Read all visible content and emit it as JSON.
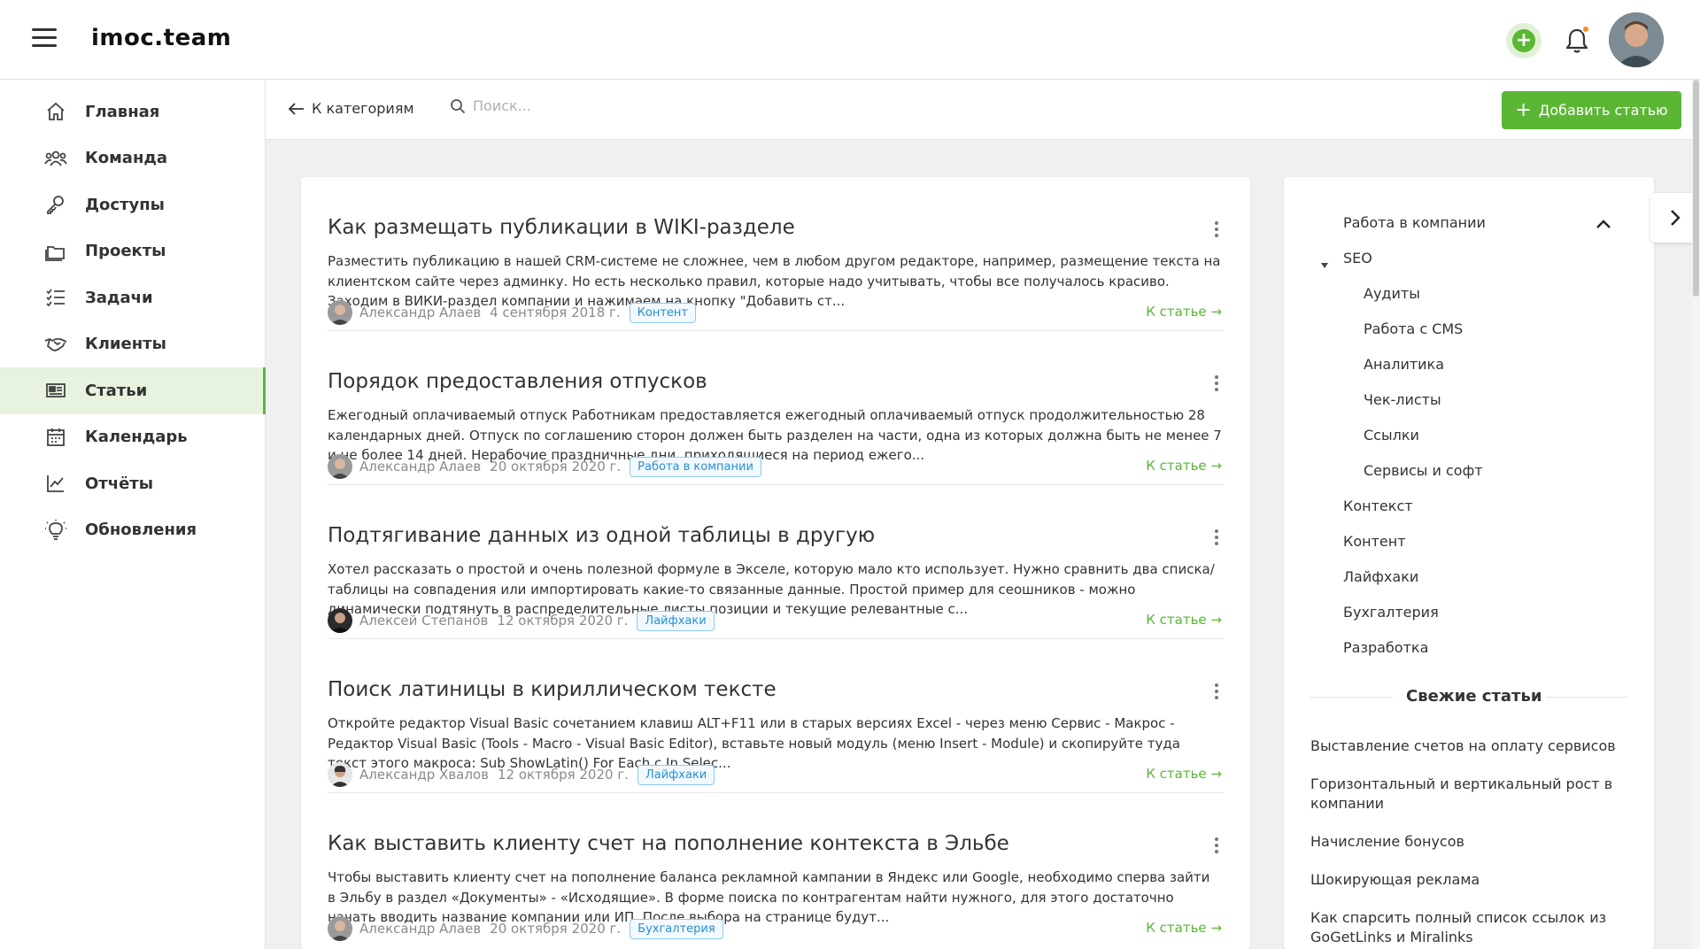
{
  "header": {
    "logo": "imoc.team",
    "notifications_dot_color": "#ff8a1f"
  },
  "colors": {
    "accent": "#5bb635",
    "tag": "#2a8fd1"
  },
  "sidebar": {
    "items": [
      {
        "label": "Главная",
        "icon": "home-icon"
      },
      {
        "label": "Команда",
        "icon": "team-icon"
      },
      {
        "label": "Доступы",
        "icon": "key-icon"
      },
      {
        "label": "Проекты",
        "icon": "folder-icon"
      },
      {
        "label": "Задачи",
        "icon": "tasks-icon"
      },
      {
        "label": "Клиенты",
        "icon": "handshake-icon"
      },
      {
        "label": "Статьи",
        "icon": "newspaper-icon",
        "active": true
      },
      {
        "label": "Календарь",
        "icon": "calendar-icon"
      },
      {
        "label": "Отчёты",
        "icon": "chart-icon"
      },
      {
        "label": "Обновления",
        "icon": "bulb-icon"
      }
    ]
  },
  "toolbar": {
    "back_label": "К категориям",
    "search_placeholder": "Поиск...",
    "add_label": "Добавить статью"
  },
  "articles": [
    {
      "title": "Как размещать публикации в WIKI-разделе",
      "text": "Разместить публикацию в нашей CRM-системе не сложнее, чем в любом другом редакторе, например, размещение текста на клиентском сайте через админку.  Но есть несколько правил, которые надо учитывать, чтобы все получалось красиво.   Заходим в ВИКИ-раздел компании и нажимаем на кнопку \"Добавить ст...",
      "author": "Александр Алаев",
      "date": "4 сентября 2018 г.",
      "tag": "Контент",
      "link": "К статье →"
    },
    {
      "title": "Порядок предоставления отпусков",
      "text": "Ежегодный оплачиваемый отпуск Работникам предоставляется ежегодный оплачиваемый отпуск продолжительностью 28 календарных дней. Отпуск по соглашению сторон должен быть разделен на части, одна из которых должна быть не менее 7 и не более 14 дней. Нерабочие праздничные дни, приходящиеся на период ежего...",
      "author": "Александр Алаев",
      "date": "20 октября 2020 г.",
      "tag": "Работа в компании",
      "link": "К статье →"
    },
    {
      "title": "Подтягивание данных из одной таблицы в другую",
      "text": "Хотел рассказать о простой и очень полезной формуле в Экселе, которую мало кто использует. Нужно сравнить два списка/таблицы на совпадения или импортировать какие-то связанные данные. Простой пример для сеошников - можно динамически подтянуть в распределительные листы позиции и текущие релевантные с...",
      "author": "Алексей Степанов",
      "date": "12 октября 2020 г.",
      "tag": "Лайфхаки",
      "link": "К статье →"
    },
    {
      "title": "Поиск латиницы в кириллическом тексте",
      "text": "Откройте редактор Visual Basic сочетанием клавиш ALT+F11 или в старых версиях Excel - через меню Сервис - Макрос - Редактор Visual Basic (Tools - Macro - Visual Basic Editor), вставьте новый модуль (меню Insert - Module) и скопируйте туда текст этого макроса: Sub ShowLatin()  For Each c In Selec...",
      "author": "Александр Хвалов",
      "date": "12 октября 2020 г.",
      "tag": "Лайфхаки",
      "link": "К статье →"
    },
    {
      "title": "Как выставить клиенту счет на пополнение контекста в Эльбе",
      "text": "Чтобы выставить клиенту счет на пополнение баланса рекламной кампании в Яндекс или Google, необходимо сперва зайти в Эльбу в раздел «Документы» - «Исходящие». В форме поиска по контрагентам найти нужного, для этого достаточно начать вводить название компании или ИП. После выбора на странице будут...",
      "author": "Александр Алаев",
      "date": "20 октября 2020 г.",
      "tag": "Бухгалтерия",
      "link": "К статье →"
    }
  ],
  "categories": [
    {
      "label": "Работа в компании",
      "level": 0
    },
    {
      "label": "SEO",
      "level": 0,
      "expanded": true
    },
    {
      "label": "Аудиты",
      "level": 1
    },
    {
      "label": "Работа с CMS",
      "level": 1
    },
    {
      "label": "Аналитика",
      "level": 1
    },
    {
      "label": "Чек-листы",
      "level": 1
    },
    {
      "label": "Ссылки",
      "level": 1
    },
    {
      "label": "Сервисы и софт",
      "level": 1
    },
    {
      "label": "Контекст",
      "level": 0
    },
    {
      "label": "Контент",
      "level": 0
    },
    {
      "label": "Лайфхаки",
      "level": 0
    },
    {
      "label": "Бухгалтерия",
      "level": 0
    },
    {
      "label": "Разработка",
      "level": 0
    }
  ],
  "fresh": {
    "title": "Свежие статьи",
    "items": [
      "Выставление счетов на оплату сервисов",
      "Горизонтальный и вертикальный рост в компании",
      "Начисление бонусов",
      "Шокирующая реклама",
      "Как спарсить полный список ссылок из GoGetLinks и Miralinks"
    ]
  }
}
